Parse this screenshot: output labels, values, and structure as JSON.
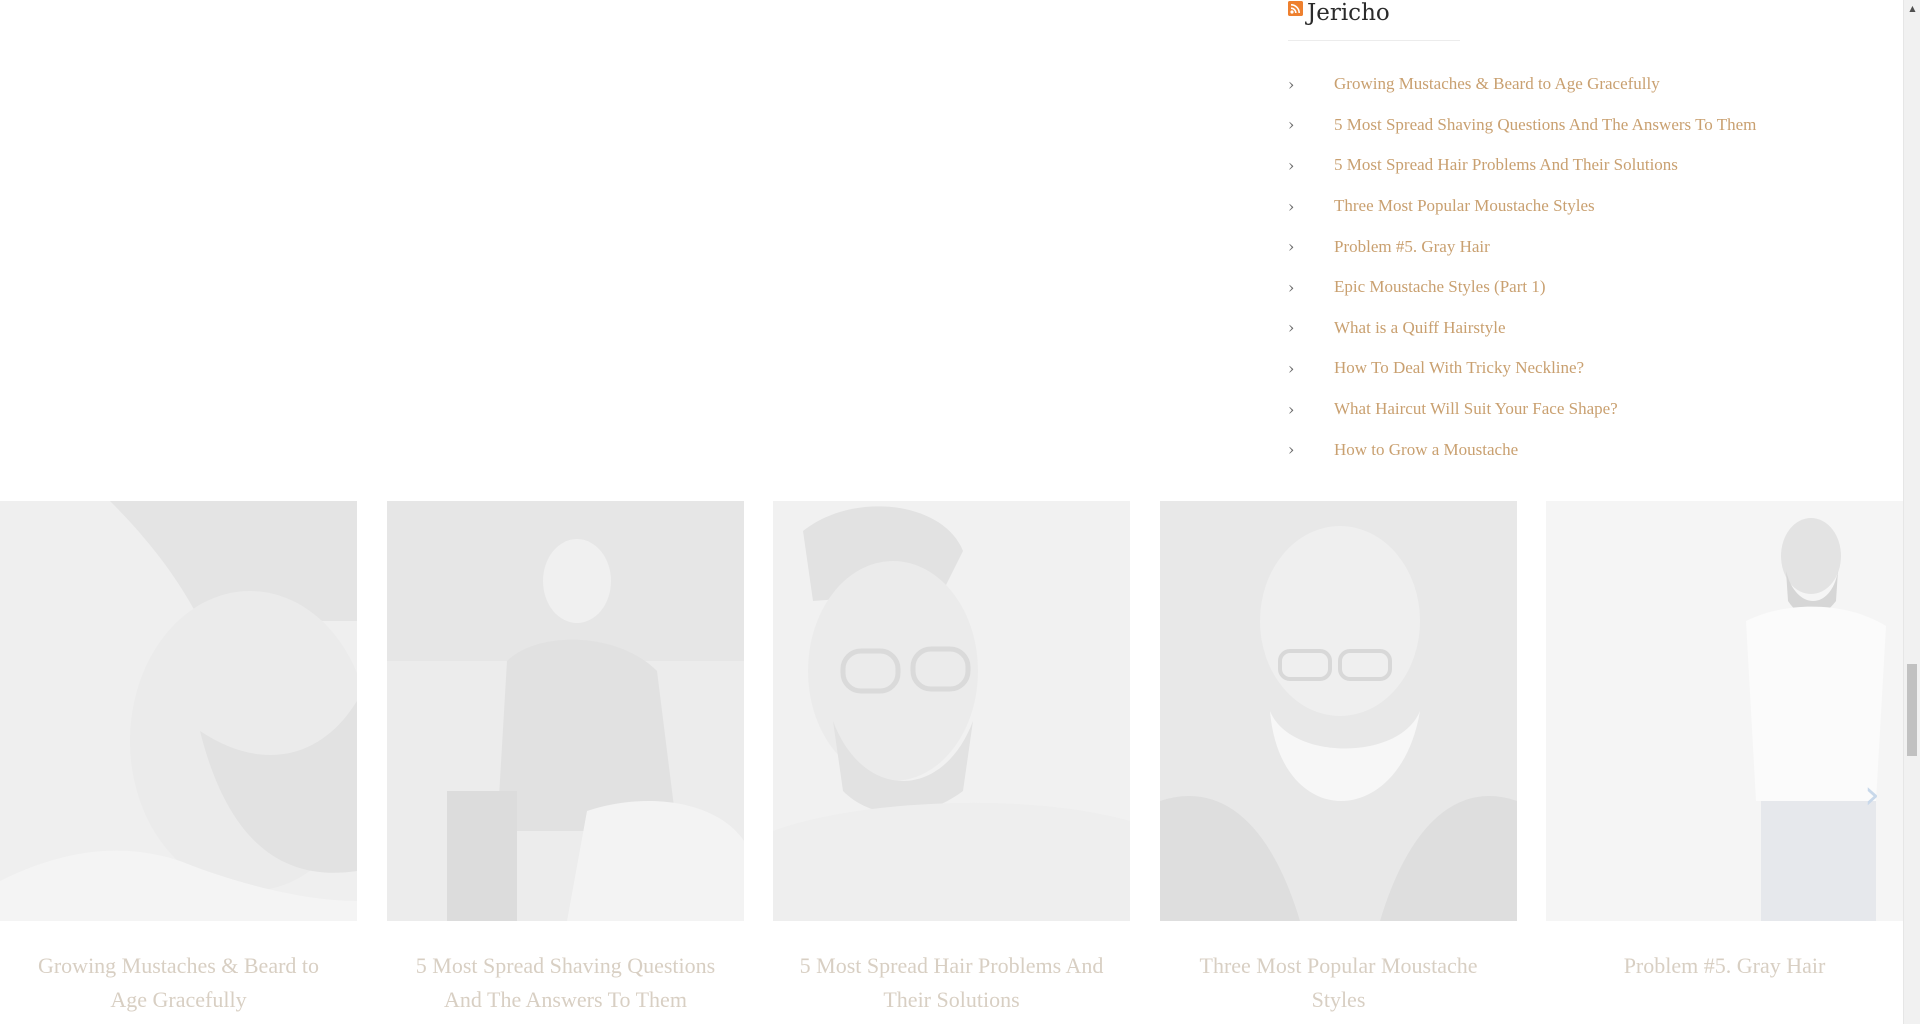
{
  "widget": {
    "title": "Jericho",
    "items": [
      {
        "label": "Growing Mustaches & Beard to Age Gracefully"
      },
      {
        "label": "5 Most Spread Shaving Questions And The Answers To Them"
      },
      {
        "label": "5 Most Spread Hair Problems And Their Solutions"
      },
      {
        "label": "Three Most Popular Moustache Styles"
      },
      {
        "label": "Problem #5. Gray Hair"
      },
      {
        "label": "Epic Moustache Styles (Part 1)"
      },
      {
        "label": "What is a Quiff Hairstyle"
      },
      {
        "label": "How To Deal With Tricky Neckline?"
      },
      {
        "label": "What Haircut Will Suit Your Face Shape?"
      },
      {
        "label": "How to Grow a Moustache"
      }
    ]
  },
  "carousel": {
    "posts": [
      {
        "title": "Growing Mustaches & Beard to Age Gracefully"
      },
      {
        "title": "5 Most Spread Shaving Questions And The Answers To Them"
      },
      {
        "title": "5 Most Spread Hair Problems And Their Solutions"
      },
      {
        "title": "Three Most Popular Moustache Styles"
      },
      {
        "title": "Problem #5. Gray Hair"
      }
    ]
  },
  "icons": {
    "rss": "rss-feed-icon",
    "bullet": "chevron-right-icon",
    "next": "carousel-next-arrow-icon"
  },
  "colors": {
    "link": "#c9a070",
    "card_title": "#d8cfc3",
    "rss": "#ee802f"
  }
}
